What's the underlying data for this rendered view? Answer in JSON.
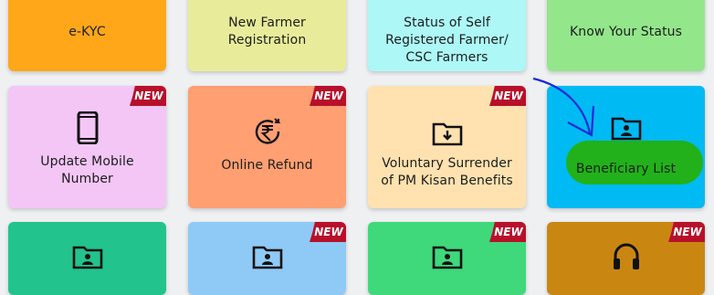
{
  "badge_text": "NEW",
  "cards": [
    {
      "label": "e-KYC",
      "color": "#ffa719",
      "icon": ""
    },
    {
      "label": "New Farmer Registration",
      "color": "#e8ec9a",
      "icon": ""
    },
    {
      "label": "Status of Self Registered Farmer/ CSC Farmers",
      "color": "#adf7f7",
      "icon": ""
    },
    {
      "label": "Know Your Status",
      "color": "#93e68a",
      "icon": ""
    },
    {
      "label": "Update Mobile Number",
      "color": "#f3c6f6",
      "icon": "mobile-phone-icon",
      "badge": true
    },
    {
      "label": "Online Refund",
      "color": "#ff9f72",
      "icon": "rupee-refund-icon",
      "badge": true
    },
    {
      "label": "Voluntary Surrender of PM Kisan Benefits",
      "color": "#ffe2b0",
      "icon": "folder-download-icon",
      "badge": true
    },
    {
      "label": "Beneficiary List",
      "color": "#00baf3",
      "icon": "folder-user-icon"
    },
    {
      "label": "",
      "color": "#22c38c",
      "icon": "folder-user-icon"
    },
    {
      "label": "",
      "color": "#8fcaf6",
      "icon": "folder-user-icon",
      "badge": true
    },
    {
      "label": "",
      "color": "#3fd87b",
      "icon": "folder-user-icon",
      "badge": true
    },
    {
      "label": "",
      "color": "#c98712",
      "icon": "headphones-icon",
      "badge": true
    }
  ]
}
